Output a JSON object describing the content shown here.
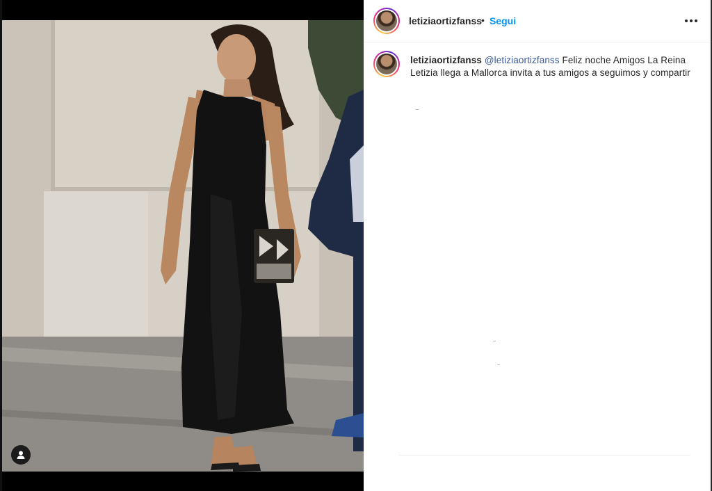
{
  "post": {
    "username": "letiziaortizfanss",
    "separator": "•",
    "follow_label": "Segui",
    "more_label": "More options"
  },
  "caption": {
    "author": "letiziaortizfanss",
    "mention": "@letiziaortizfanss",
    "text": "Feliz noche Amigos La Reina Letizia llega a Mallorca invita a tus amigos a seguimos y compartir"
  },
  "icons": {
    "more": "more-horizontal-icon",
    "user_tag": "user-tag-icon",
    "avatar": "profile-avatar"
  },
  "colors": {
    "accent_link": "#0095f6",
    "mention": "#385898",
    "text": "#262626",
    "story_ring": [
      "#f9ce34",
      "#ee2a7b",
      "#6228d7"
    ]
  }
}
